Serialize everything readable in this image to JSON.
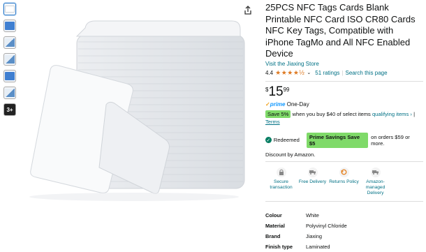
{
  "gallery": {
    "thumbnails": [
      {
        "kind": "card"
      },
      {
        "kind": "blue"
      },
      {
        "kind": "mix"
      },
      {
        "kind": "mix"
      },
      {
        "kind": "blue"
      },
      {
        "kind": "mix"
      }
    ],
    "more_label": "3+"
  },
  "product": {
    "title": "25PCS NFC Tags Cards Blank Printable NFC Card ISO CR80 Cards NFC Key Tags, Compatible with iPhone TagMo and All NFC Enabled Device",
    "store_link": "Visit the Jiaxing Store",
    "rating_value": "4.4",
    "stars": "★★★★½",
    "ratings_count": "51 ratings",
    "search_link": "Search this page"
  },
  "price": {
    "currency": "$",
    "whole": "15",
    "fraction": "99"
  },
  "prime": {
    "label": "prime",
    "delivery": "One-Day"
  },
  "coupon": {
    "badge": "Save 5%",
    "text": "when you buy $40 of select items",
    "link": "qualifying items",
    "terms": "Terms"
  },
  "savings": {
    "redeemed": "Redeemed",
    "pill": "Prime Savings Save $5",
    "text": "on orders $59 or more."
  },
  "discount_text": "Discount by Amazon.",
  "features": [
    {
      "icon": "lock-icon",
      "label": "Secure transaction"
    },
    {
      "icon": "truck-icon",
      "label": "Free Delivery"
    },
    {
      "icon": "return-icon",
      "label": "Returns Policy"
    },
    {
      "icon": "delivery-van-icon",
      "label": "Amazon-managed Delivery"
    }
  ],
  "specs": [
    {
      "key": "Colour",
      "value": "White"
    },
    {
      "key": "Material",
      "value": "Polyvinyl Chloride"
    },
    {
      "key": "Brand",
      "value": "Jiaxing"
    },
    {
      "key": "Finish type",
      "value": "Laminated"
    }
  ],
  "colors": {
    "link": "#007185",
    "star": "#de7921",
    "prime": "#1399ff",
    "save_badge": "#7fda69"
  }
}
